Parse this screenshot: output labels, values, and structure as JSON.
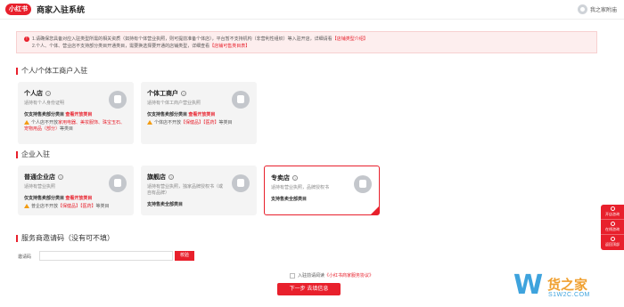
{
  "header": {
    "logo": "小红书",
    "title": "商家入驻系统",
    "user_label": "我之家附庙"
  },
  "notice": {
    "line1_prefix": "1.请确保您具备对应入驻类型所需的相关资质（如持有个体营业执照，则可提前准备个体店），平台暂不支持机构（非营利性组织）等入驻开店，详细请看",
    "line1_link": "【店铺类型介绍】",
    "line2_prefix": "2.个人、个体、营业店不支持部分类目开通类目，需要换选择要开通的店铺类型，详细查看",
    "line2_link": "【店铺可售类目表】"
  },
  "section_personal": "个人/个体工商户入驻",
  "section_enterprise": "企业入驻",
  "section_invite": "服务商邀请码（没有可不填）",
  "cards": {
    "personal": {
      "title": "个人店",
      "desc": "适持有个人身份证明",
      "bold_prefix": "仅支持售卖部分类目",
      "bold_link": "查看开放类目",
      "warn_prefix": "个人店不开放",
      "warn_mid": "家用电器、美妆服饰、珠宝玉石、宠物用品（部分）",
      "warn_suffix": "等类目"
    },
    "individual": {
      "title": "个体工商户",
      "desc": "适持有个体工商户营业执照",
      "bold_prefix": "仅支持售卖部分类目",
      "bold_link": "查看开放类目",
      "warn_prefix": "个体店不开放",
      "warn_mid": "【保健品】【医药】",
      "warn_suffix": "等类目"
    },
    "regular": {
      "title": "普通企业店",
      "desc": "适持有营业执照",
      "bold_prefix": "仅支持售卖部分类目",
      "bold_link": "查看开放类目",
      "warn_prefix": "普企店不开放",
      "warn_mid": "【保健品】【医药】",
      "warn_suffix": "等类目"
    },
    "flagship": {
      "title": "旗舰店",
      "desc": "适持有营业执照，独家品牌授权书（或自有品牌）",
      "bold": "支持售卖全部类目"
    },
    "specialty": {
      "title": "专卖店",
      "desc": "适持有营业执照，品牌授权书",
      "bold": "支持售卖全部类目"
    }
  },
  "invite": {
    "label": "邀请码",
    "placeholder": "",
    "verify_label": "校验"
  },
  "agree": {
    "prefix": "入驻前请阅读",
    "link": "《小红书商家服务协议》"
  },
  "next_label": "下一步 去填信息",
  "sidebar": {
    "items": [
      {
        "label": "开店咨询",
        "icon": "chat-icon"
      },
      {
        "label": "在线咨询",
        "icon": "support-icon"
      },
      {
        "label": "返回顶部",
        "icon": "top-icon"
      }
    ]
  },
  "watermark": {
    "letter": "W",
    "cn": "货之家",
    "en": "S1W2C.COM"
  },
  "colors": {
    "accent": "#e8202c",
    "warning": "#f39c12"
  }
}
